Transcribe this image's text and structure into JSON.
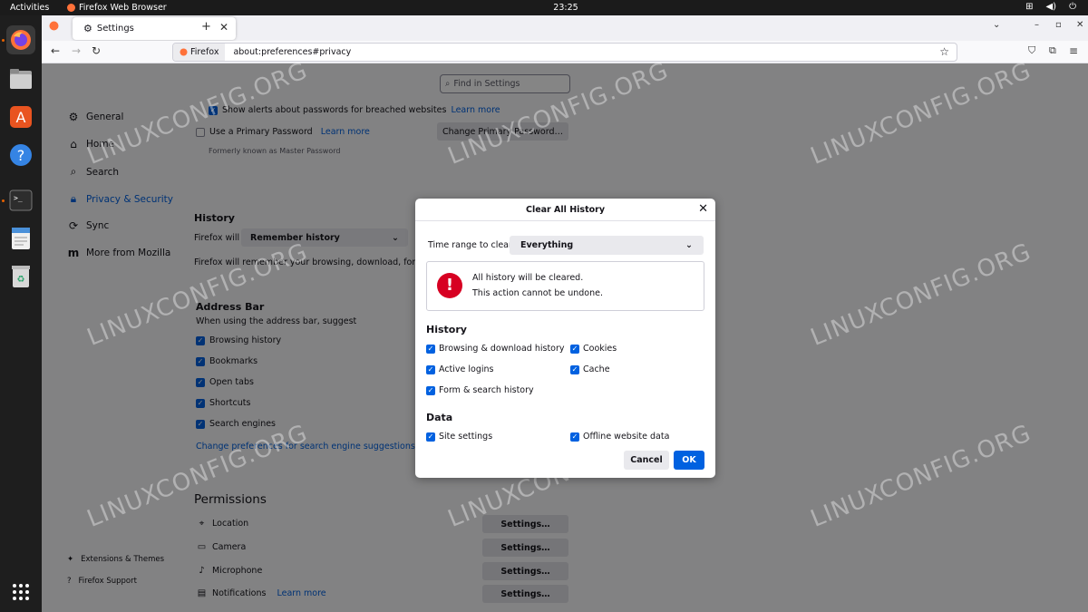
{
  "topbar": {
    "activities": "Activities",
    "app_name": "Firefox Web Browser",
    "clock": "23:25"
  },
  "browser": {
    "tab_title": "Settings",
    "identity_label": "Firefox",
    "url": "about:preferences#privacy"
  },
  "settings": {
    "search_placeholder": "Find in Settings",
    "categories": [
      "General",
      "Home",
      "Search",
      "Privacy & Security",
      "Sync",
      "More from Mozilla"
    ],
    "footer_links": [
      "Extensions & Themes",
      "Firefox Support"
    ],
    "passwords": {
      "alerts_label": "Show alerts about passwords for breached websites",
      "alerts_link": "Learn more",
      "primary_label": "Use a Primary Password",
      "primary_link": "Learn more",
      "primary_button": "Change Primary Password…",
      "formerly": "Formerly known as Master Password"
    },
    "history": {
      "heading": "History",
      "firefox_will": "Firefox will",
      "mode": "Remember history",
      "description": "Firefox will remember your browsing, download, form, and"
    },
    "address_bar": {
      "heading": "Address Bar",
      "subtitle": "When using the address bar, suggest",
      "items": [
        "Browsing history",
        "Bookmarks",
        "Open tabs",
        "Shortcuts",
        "Search engines"
      ],
      "link": "Change preferences for search engine suggestions"
    },
    "permissions": {
      "heading": "Permissions",
      "items": [
        "Location",
        "Camera",
        "Microphone",
        "Notifications"
      ],
      "learn_more": "Learn more",
      "settings_button": "Settings…"
    }
  },
  "watermark": "LINUXCONFIG.ORG",
  "dialog": {
    "title": "Clear All History",
    "time_range_label": "Time range to clear:",
    "time_range_value": "Everything",
    "warning_line1": "All history will be cleared.",
    "warning_line2": "This action cannot be undone.",
    "history_heading": "History",
    "history_items": [
      "Browsing & download history",
      "Cookies",
      "Active logins",
      "Cache",
      "Form & search history"
    ],
    "data_heading": "Data",
    "data_items": [
      "Site settings",
      "Offline website data"
    ],
    "cancel": "Cancel",
    "ok": "OK"
  },
  "colors": {
    "accent": "#0061e0",
    "warning": "#d70022",
    "dock": "#1e1e1e"
  }
}
